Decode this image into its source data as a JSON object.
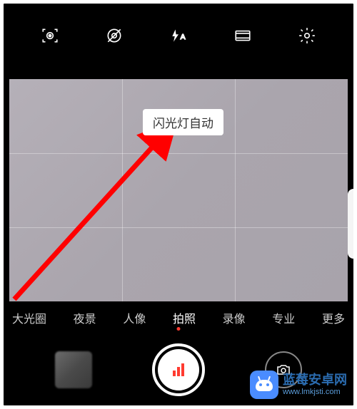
{
  "toolbar": {
    "icons": {
      "ai_lens": "ai-lens-icon",
      "filter_off": "filter-off-icon",
      "flash": "flash-auto-icon",
      "aspect": "aspect-ratio-icon",
      "settings": "settings-icon"
    },
    "flash_mode_suffix": "A"
  },
  "flash_tooltip": "闪光灯自动",
  "modes": {
    "items": [
      {
        "label": "大光圈",
        "partial": true
      },
      {
        "label": "夜景"
      },
      {
        "label": "人像"
      },
      {
        "label": "拍照",
        "active": true
      },
      {
        "label": "录像"
      },
      {
        "label": "专业"
      },
      {
        "label": "更多",
        "partial": true
      }
    ]
  },
  "bottom": {
    "gallery": "gallery-thumbnail",
    "shutter": "shutter-button",
    "switch": "switch-camera"
  },
  "watermark": {
    "title": "蓝莓安卓网",
    "url": "www.lmkjsti.com"
  },
  "colors": {
    "arrow": "#ff0000",
    "accent_dot": "#ff3b30",
    "watermark_brand": "#4a8cff"
  }
}
